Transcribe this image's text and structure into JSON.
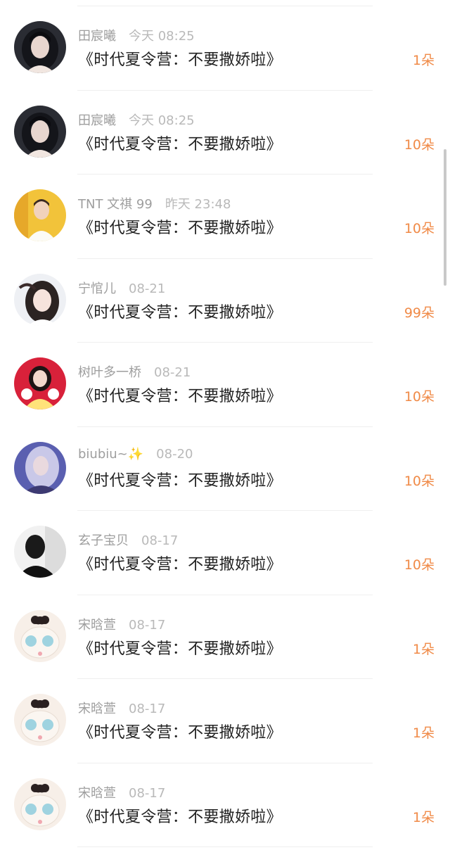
{
  "gift_list": {
    "items": [
      {
        "user": "田宸曦",
        "time": "今天 08:25",
        "title": "《时代夏令营：不要撒娇啦》",
        "gift": "1朵",
        "avatar": "dark-portrait"
      },
      {
        "user": "田宸曦",
        "time": "今天 08:25",
        "title": "《时代夏令营：不要撒娇啦》",
        "gift": "10朵",
        "avatar": "dark-portrait"
      },
      {
        "user": "TNT 文祺 99",
        "time": "昨天 23:48",
        "title": "《时代夏令营：不要撒娇啦》",
        "gift": "10朵",
        "avatar": "yellow-portrait"
      },
      {
        "user": "宁悺儿",
        "time": "08-21",
        "title": "《时代夏令营：不要撒娇啦》",
        "gift": "99朵",
        "avatar": "light-portrait"
      },
      {
        "user": "树叶多一桥",
        "time": "08-21",
        "title": "《时代夏令营：不要撒娇啦》",
        "gift": "10朵",
        "avatar": "red-portrait"
      },
      {
        "user": "biubiu~✨",
        "time": "08-20",
        "title": "《时代夏令营：不要撒娇啦》",
        "gift": "10朵",
        "avatar": "purple-portrait"
      },
      {
        "user": "玄子宝贝",
        "time": "08-17",
        "title": "《时代夏令营：不要撒娇啦》",
        "gift": "10朵",
        "avatar": "shadow-portrait"
      },
      {
        "user": "宋晗萱",
        "time": "08-17",
        "title": "《时代夏令营：不要撒娇啦》",
        "gift": "1朵",
        "avatar": "toy-bear"
      },
      {
        "user": "宋晗萱",
        "time": "08-17",
        "title": "《时代夏令营：不要撒娇啦》",
        "gift": "1朵",
        "avatar": "toy-bear"
      },
      {
        "user": "宋晗萱",
        "time": "08-17",
        "title": "《时代夏令营：不要撒娇啦》",
        "gift": "1朵",
        "avatar": "toy-bear"
      }
    ]
  },
  "colors": {
    "gift_accent": "#f08a47",
    "username": "#9e9e9e",
    "title": "#222222"
  }
}
